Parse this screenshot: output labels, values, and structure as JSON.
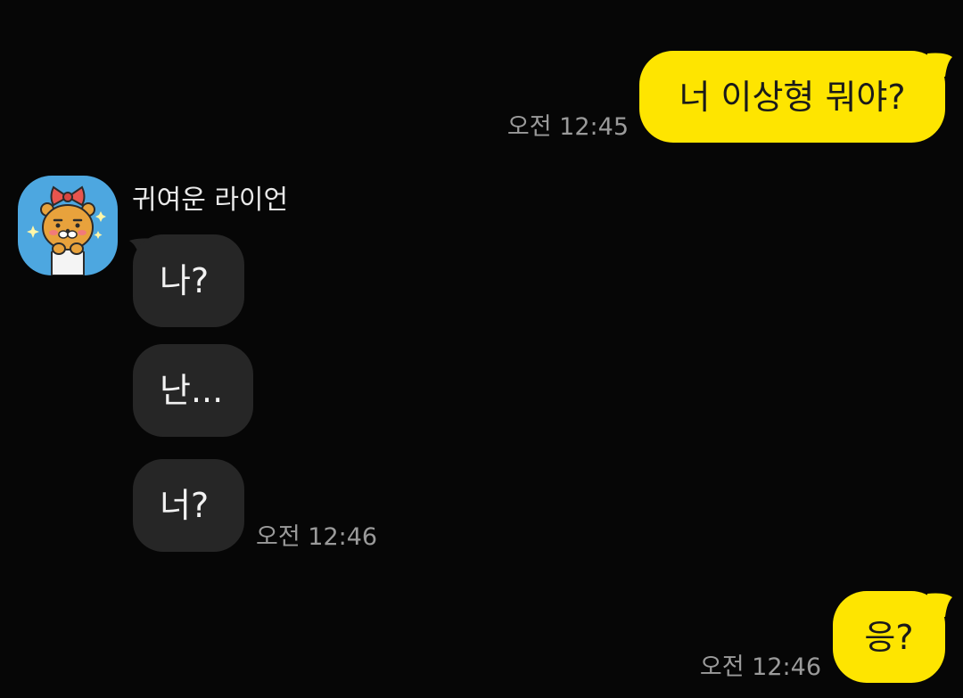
{
  "chat": {
    "messages": [
      {
        "id": "m1",
        "direction": "outgoing",
        "text": "너 이상형 뭐야?",
        "time": "오전 12:45"
      },
      {
        "id": "m2",
        "direction": "incoming",
        "text": "나?"
      },
      {
        "id": "m3",
        "direction": "incoming",
        "text": "난..."
      },
      {
        "id": "m4",
        "direction": "incoming",
        "text": "너?",
        "time": "오전 12:46"
      },
      {
        "id": "m5",
        "direction": "outgoing",
        "text": "응?",
        "time": "오전 12:46"
      }
    ],
    "contact": {
      "name": "귀여운 라이언",
      "avatar_icon": "ryan-character-with-ribbon-icon"
    }
  },
  "colors": {
    "background": "#060606",
    "outgoing_bubble": "#fee500",
    "incoming_bubble": "#262626",
    "timestamp": "#9a9a9a",
    "avatar_background": "#4da7e0"
  }
}
